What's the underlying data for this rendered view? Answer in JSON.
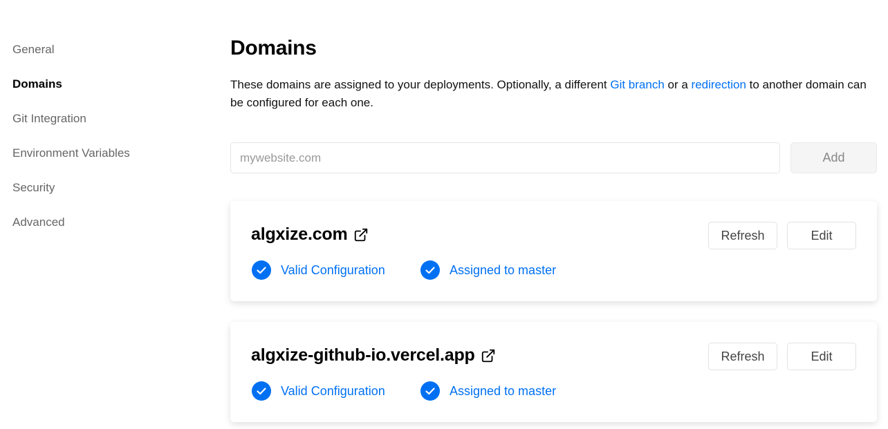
{
  "sidebar": {
    "items": [
      {
        "label": "General"
      },
      {
        "label": "Domains"
      },
      {
        "label": "Git Integration"
      },
      {
        "label": "Environment Variables"
      },
      {
        "label": "Security"
      },
      {
        "label": "Advanced"
      }
    ],
    "active": "Domains"
  },
  "page": {
    "title": "Domains",
    "desc_part1": "These domains are assigned to your deployments. Optionally, a different ",
    "desc_link1": "Git branch",
    "desc_part2": " or a ",
    "desc_link2": "redirection",
    "desc_part3": " to another domain can be configured for each one."
  },
  "add_domain": {
    "placeholder": "mywebsite.com",
    "value": "",
    "button_label": "Add"
  },
  "domains": [
    {
      "name": "algxize.com",
      "refresh_label": "Refresh",
      "edit_label": "Edit",
      "config_status": "Valid Configuration",
      "assignment": "Assigned to master"
    },
    {
      "name": "algxize-github-io.vercel.app",
      "refresh_label": "Refresh",
      "edit_label": "Edit",
      "config_status": "Valid Configuration",
      "assignment": "Assigned to master"
    }
  ],
  "colors": {
    "accent": "#0070f3",
    "muted_text": "#666666",
    "border": "#e5e5e5"
  },
  "icons": {
    "external": "external-link-icon",
    "check": "check-circle-icon"
  }
}
